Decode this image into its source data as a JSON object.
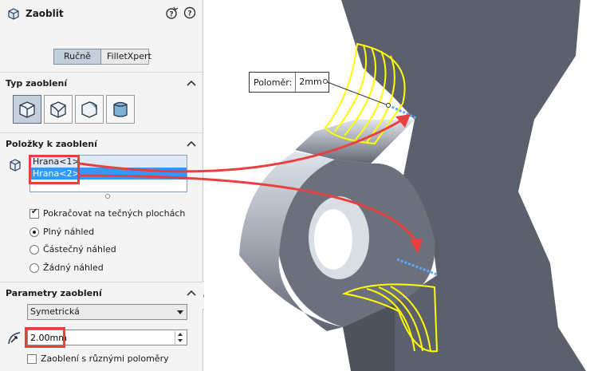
{
  "feature": {
    "title": "Zaoblit",
    "help_icon": "help-icon",
    "ok_icon": "checkmark-icon",
    "cancel_icon": "close-icon"
  },
  "mode_tabs": [
    {
      "label": "Ručně",
      "active": true
    },
    {
      "label": "FilletXpert",
      "active": false
    }
  ],
  "sections": {
    "type": {
      "title": "Typ zaoblení",
      "buttons": [
        "constant-radius-fillet-icon",
        "variable-radius-fillet-icon",
        "face-fillet-icon",
        "full-round-fillet-icon"
      ],
      "active_index": 0
    },
    "items": {
      "title": "Položky k zaoblení",
      "list": [
        "Hrana<1>",
        "Hrana<2>"
      ],
      "selected_index": 1,
      "tangent_propagation": {
        "label": "Pokračovat na tečných plochách",
        "checked": true
      },
      "preview_options": [
        {
          "label": "Plný náhled",
          "selected": true
        },
        {
          "label": "Částečný náhled",
          "selected": false
        },
        {
          "label": "Žádný náhled",
          "selected": false
        }
      ]
    },
    "params": {
      "title": "Parametry zaoblení",
      "method": "Symetrická",
      "radius": "2.00mm",
      "multi_radius": {
        "label": "Zaoblení s různými poloměry",
        "checked": false
      }
    }
  },
  "viewport": {
    "callout_key": "Poloměr:",
    "callout_value": "2mm"
  },
  "colors": {
    "accent_red": "#e8403e",
    "selection_blue": "#3399ff",
    "preview_yellow": "#ffff00",
    "model_gray": "#5c606c"
  }
}
